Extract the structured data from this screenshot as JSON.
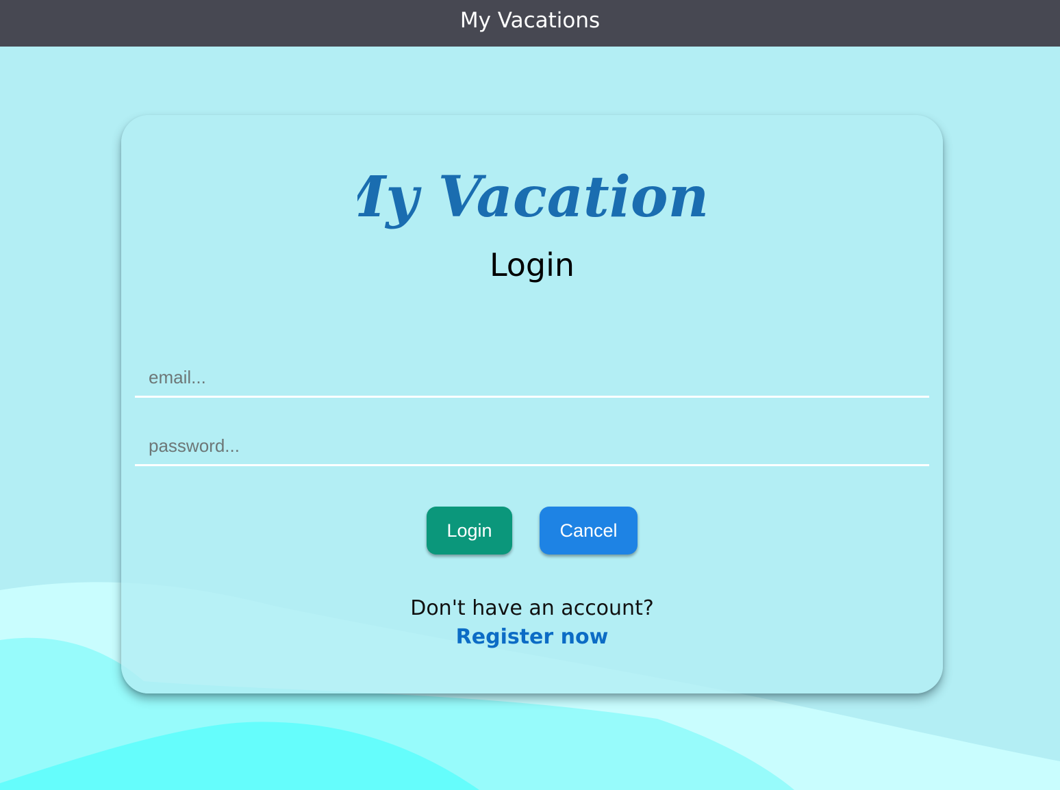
{
  "header": {
    "title": "My Vacations"
  },
  "card": {
    "logo_text": "My Vacations",
    "title": "Login",
    "email": {
      "value": "",
      "placeholder": "email..."
    },
    "password": {
      "value": "",
      "placeholder": "password..."
    },
    "buttons": {
      "login_label": "Login",
      "cancel_label": "Cancel"
    },
    "register_prompt": "Don't have an account?",
    "register_link": "Register now"
  },
  "colors": {
    "header_bg": "#474852",
    "page_bg": "#b3eef4",
    "login_button": "#0b977b",
    "cancel_button": "#1e83e4",
    "link": "#0c6cc5",
    "logo": "#1a6db0"
  }
}
